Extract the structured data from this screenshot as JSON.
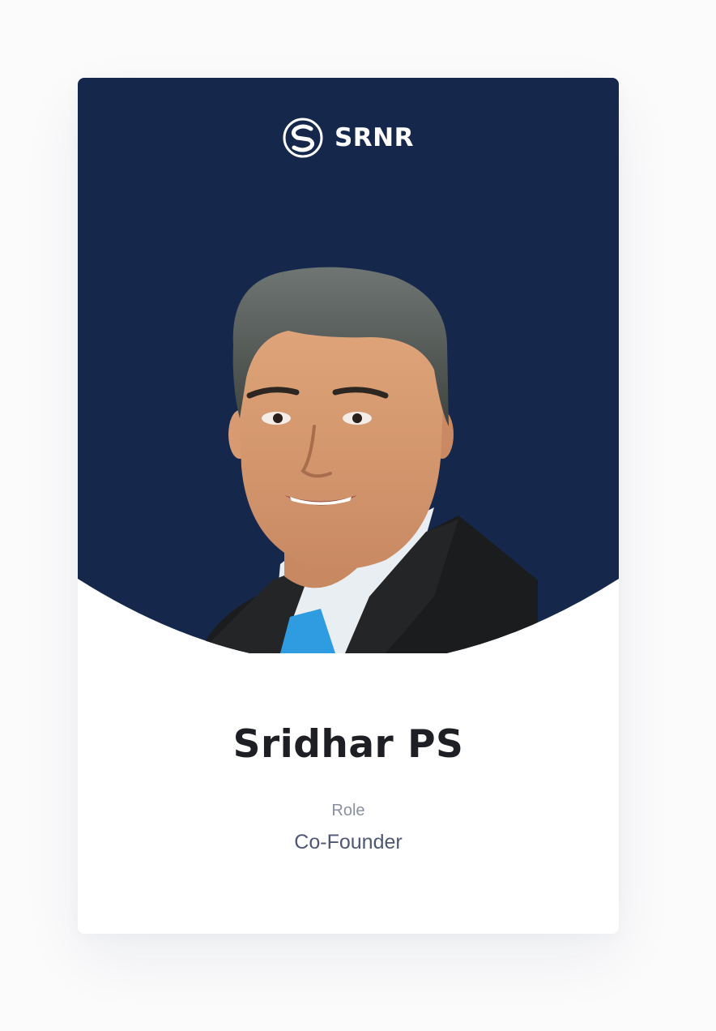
{
  "brand": {
    "name": "SRNR",
    "logo_icon": "srnr-s-logo-icon"
  },
  "profile": {
    "name": "Sridhar PS",
    "role_label": "Role",
    "role_value": "Co-Founder",
    "photo": "portrait-photo"
  },
  "colors": {
    "hero_background": "#15284c",
    "name_text": "#1e1f24",
    "role_label_text": "#8a90a2",
    "role_value_text": "#4f5775",
    "tie": "#2f9be0",
    "suit": "#1b1c1d"
  }
}
